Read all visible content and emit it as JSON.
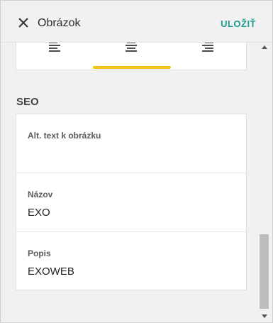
{
  "header": {
    "title": "Obrázok",
    "save_label": "ULOŽIŤ"
  },
  "alignment": {
    "options": [
      "align-left",
      "align-center",
      "align-right"
    ],
    "active": "align-center",
    "accent_color": "#f6c21b"
  },
  "seo": {
    "section_title": "SEO",
    "fields": [
      {
        "label": "Alt. text k obrázku",
        "value": ""
      },
      {
        "label": "Názov",
        "value": "EXO"
      },
      {
        "label": "Popis",
        "value": "EXOWEB"
      }
    ]
  },
  "colors": {
    "save": "#1a9e8f",
    "background": "#f1f1f1"
  }
}
